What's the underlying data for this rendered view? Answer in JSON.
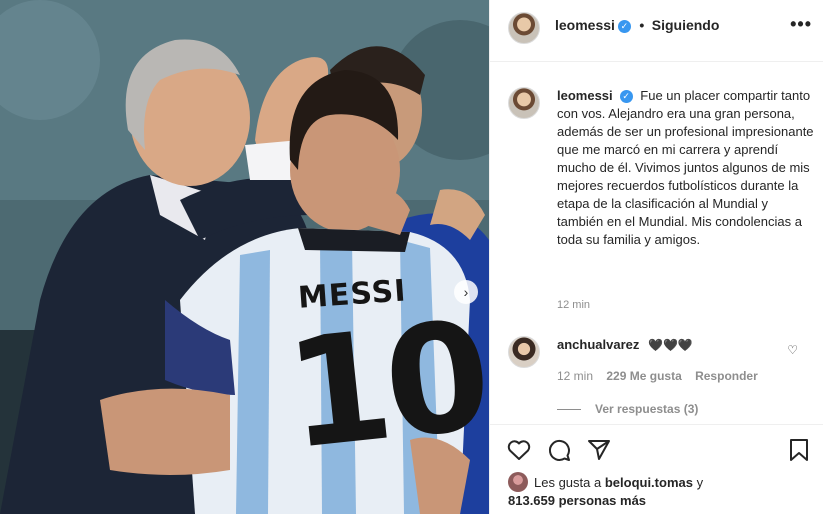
{
  "post": {
    "author": "leomessi",
    "follow_state": "Siguiendo",
    "separator": "•",
    "verified_glyph": "✓",
    "more_glyph": "•••"
  },
  "photo": {
    "jersey_name": "MESSI",
    "jersey_number": "10",
    "next_glyph": "›"
  },
  "caption": {
    "username": "leomessi",
    "text": "Fue un placer compartir tanto con vos. Alejandro era una gran persona, además de ser un profesional impresionante que me marcó en mi carrera y aprendí mucho de él. Vivimos juntos algunos de mis mejores recuerdos futbolísticos durante la etapa de la clasificación al Mundial y también en el Mundial. Mis condolencias a toda su familia y amigos.",
    "time": "12 min"
  },
  "comment": {
    "username": "anchualvarez",
    "text": "🖤🖤🖤",
    "time": "12 min",
    "likes": "229 Me gusta",
    "reply": "Responder",
    "like_glyph": "♡",
    "view_replies": "Ver respuestas (3)"
  },
  "actions": {
    "likes_prefix": "Les gusta a",
    "liker": "beloqui.tomas",
    "likes_conj": "y",
    "likes_rest": "813.659 personas más"
  },
  "icons": [
    "heart-icon",
    "comment-icon",
    "share-icon",
    "bookmark-icon",
    "more-icon",
    "verified-badge-icon",
    "next-arrow-icon"
  ],
  "colors": {
    "verified": "#3897f0",
    "text": "#262626",
    "muted": "#8e8e8e",
    "border": "#efefef"
  }
}
